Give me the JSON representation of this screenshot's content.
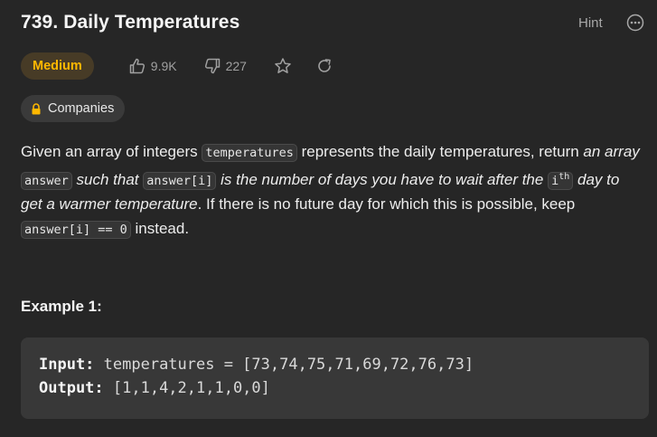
{
  "problem": {
    "title": "739. Daily Temperatures",
    "hint_label": "Hint",
    "difficulty": "Medium",
    "likes": "9.9K",
    "dislikes": "227",
    "companies_label": "Companies"
  },
  "description": {
    "t1": "Given an array of integers ",
    "c1": "temperatures",
    "t2": " represents the daily temperatures, return ",
    "i1": "an array",
    "t3": " ",
    "c2": "answer",
    "t4": " ",
    "i2": "such that",
    "t5": " ",
    "c3": "answer[i]",
    "t6": " ",
    "i3": "is the number of days you have to wait after the",
    "t7": " ",
    "c4": "i",
    "sup": "th",
    "t8": " ",
    "i4": "day to get a warmer temperature",
    "t9": ". If there is no future day for which this is possible, keep ",
    "c5": "answer[i] == 0",
    "t10": " instead."
  },
  "example": {
    "title": "Example 1:",
    "input_label": "Input:",
    "input_value": " temperatures = [73,74,75,71,69,72,76,73]",
    "output_label": "Output:",
    "output_value": " [1,1,4,2,1,1,0,0]"
  },
  "colors": {
    "background": "#262626",
    "difficulty_medium": "#ffb800",
    "difficulty_badge_bg": "#473b26"
  }
}
